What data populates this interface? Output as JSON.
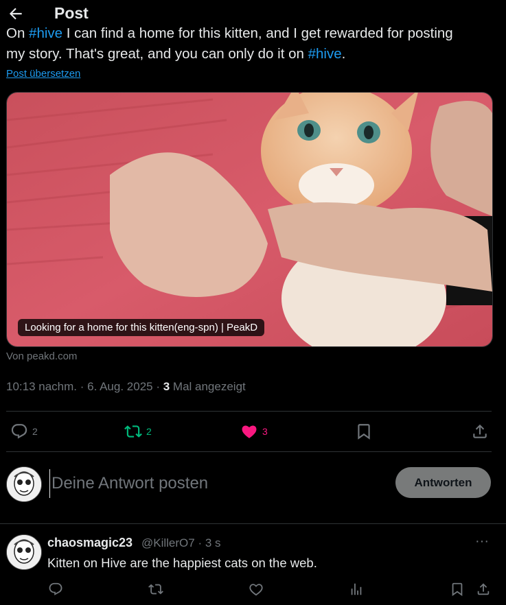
{
  "header": {
    "title": "Post"
  },
  "post": {
    "line1_prefix": "On ",
    "line1_hashtag": "#hive",
    "line1_rest": " I can find a home for this kitten, and I get rewarded for posting",
    "line2_prefix": "my story. That's great, and you can only do it on ",
    "line2_hashtag": "#hive",
    "line2_suffix": ".",
    "translate_link": "Post übersetzen",
    "media_caption": "Looking for a home for this kitten(eng-spn) | PeakD",
    "source": "Von peakd.com",
    "time": "10:13 nachm.",
    "sep1": " · ",
    "date": "6. Aug. 2025",
    "sep2": " · ",
    "views_count": "3",
    "views_label": " Mal angezeigt"
  },
  "actions": {
    "replies": "2",
    "reposts": "2",
    "likes": "3"
  },
  "reply": {
    "placeholder": "Deine Antwort posten",
    "button": "Antworten"
  },
  "comment": {
    "name": "chaosmagic23",
    "handle": "@KillerO7 · 3 s",
    "more": "···",
    "text": "Kitten on Hive are the happiest cats on the web."
  },
  "colors": {
    "accent": "#1d9bf0",
    "repost": "#00ba7c",
    "like": "#f91880",
    "muted": "#71767b"
  },
  "icons": [
    "back-arrow-icon",
    "reply-icon",
    "repost-icon",
    "heart-icon",
    "bookmark-icon",
    "share-icon",
    "analytics-icon",
    "more-icon"
  ]
}
